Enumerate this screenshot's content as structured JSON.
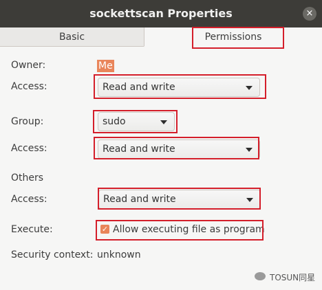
{
  "window": {
    "title": "sockettscan Properties",
    "close_glyph": "×"
  },
  "tabs": [
    {
      "label": "Basic"
    },
    {
      "label": "Permissions"
    }
  ],
  "owner": {
    "label": "Owner:",
    "value": "Me",
    "access_label": "Access:",
    "access_value": "Read and write"
  },
  "group": {
    "label": "Group:",
    "value": "sudo",
    "access_label": "Access:",
    "access_value": "Read and write"
  },
  "others": {
    "label": "Others",
    "access_label": "Access:",
    "access_value": "Read and write"
  },
  "execute": {
    "label": "Execute:",
    "checkbox_label": "Allow executing file as program",
    "checked": true
  },
  "security": {
    "label": "Security context:",
    "value": "unknown"
  },
  "watermark": {
    "right_text": "TOSUN同星"
  },
  "colors": {
    "accent": "#e9855a",
    "highlight": "#d41e2a",
    "titlebar": "#3d3c38"
  }
}
